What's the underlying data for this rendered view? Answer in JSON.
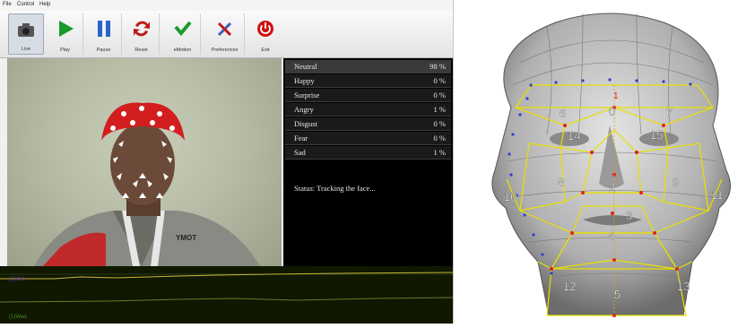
{
  "menu": [
    "File",
    "Control",
    "Help"
  ],
  "toolbar": [
    {
      "label": "Live",
      "icon": "camera-icon"
    },
    {
      "label": "Play",
      "icon": "play-icon"
    },
    {
      "label": "Pause",
      "icon": "pause-icon"
    },
    {
      "label": "Reset",
      "icon": "reset-icon"
    },
    {
      "label": "eMotion",
      "icon": "emotion-check-icon"
    },
    {
      "label": "Preferences",
      "icon": "preferences-icon"
    },
    {
      "label": "Exit",
      "icon": "power-icon"
    }
  ],
  "emotions": [
    {
      "name": "Neutral",
      "value": "98 %"
    },
    {
      "name": "Happy",
      "value": "0 %"
    },
    {
      "name": "Surprise",
      "value": "0 %"
    },
    {
      "name": "Angry",
      "value": "1 %"
    },
    {
      "name": "Disgust",
      "value": "0 %"
    },
    {
      "name": "Fear",
      "value": "0 %"
    },
    {
      "name": "Sad",
      "value": "1 %"
    }
  ],
  "status": "Status:   Tracking the face...",
  "graph_labels": [
    "(1)Wst",
    "(1)Wed"
  ],
  "shirt_text": "YMOT",
  "mesh_labels": [
    "0",
    "1",
    "2",
    "3",
    "4",
    "5",
    "6",
    "7",
    "8",
    "9",
    "10",
    "11",
    "12",
    "13",
    "14",
    "15"
  ],
  "colors": {
    "mesh_lines": "#e8e000",
    "points": "#e02020",
    "contour": "#3040d0"
  }
}
